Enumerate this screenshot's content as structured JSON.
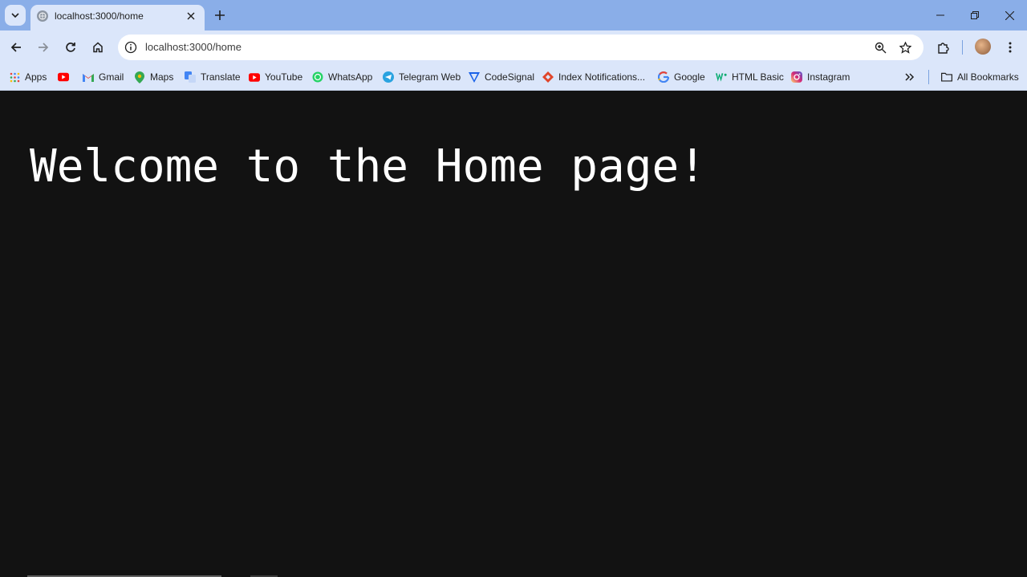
{
  "tab": {
    "title": "localhost:3000/home"
  },
  "omnibox": {
    "url": "localhost:3000/home"
  },
  "bookmarks": [
    {
      "label": "Apps",
      "icon": "apps-grid-icon"
    },
    {
      "label": "",
      "icon": "youtube-icon"
    },
    {
      "label": "Gmail",
      "icon": "gmail-icon"
    },
    {
      "label": "Maps",
      "icon": "maps-icon"
    },
    {
      "label": "Translate",
      "icon": "translate-icon"
    },
    {
      "label": "YouTube",
      "icon": "youtube-icon"
    },
    {
      "label": "WhatsApp",
      "icon": "whatsapp-icon"
    },
    {
      "label": "Telegram Web",
      "icon": "telegram-icon"
    },
    {
      "label": "CodeSignal",
      "icon": "codesignal-icon"
    },
    {
      "label": "Index Notifications...",
      "icon": "index-icon"
    },
    {
      "label": "Google",
      "icon": "google-icon"
    },
    {
      "label": "HTML Basic",
      "icon": "w3schools-icon"
    },
    {
      "label": "Instagram",
      "icon": "instagram-icon"
    }
  ],
  "all_bookmarks_label": "All Bookmarks",
  "page": {
    "heading": "Welcome to the Home page!"
  },
  "colors": {
    "titlebar": "#8aaee8",
    "toolbar": "#dbe6fa",
    "page_background": "#121212",
    "heading_text": "#ffffff"
  }
}
